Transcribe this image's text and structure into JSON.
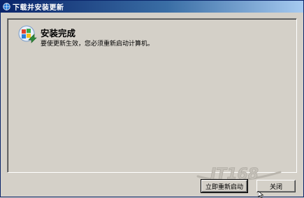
{
  "window": {
    "title": "下载并安装更新"
  },
  "content": {
    "heading": "安装完成",
    "message": "要使更新生效，您必须重新启动计算机。",
    "icon": "windows-update-icon"
  },
  "buttons": {
    "restart_label": "立即重新启动",
    "close_label": "关闭"
  },
  "watermark": {
    "text": "IT168"
  },
  "colors": {
    "titlebar_start": "#0a246a",
    "titlebar_end": "#a6caf0",
    "face": "#d4d0c8"
  }
}
